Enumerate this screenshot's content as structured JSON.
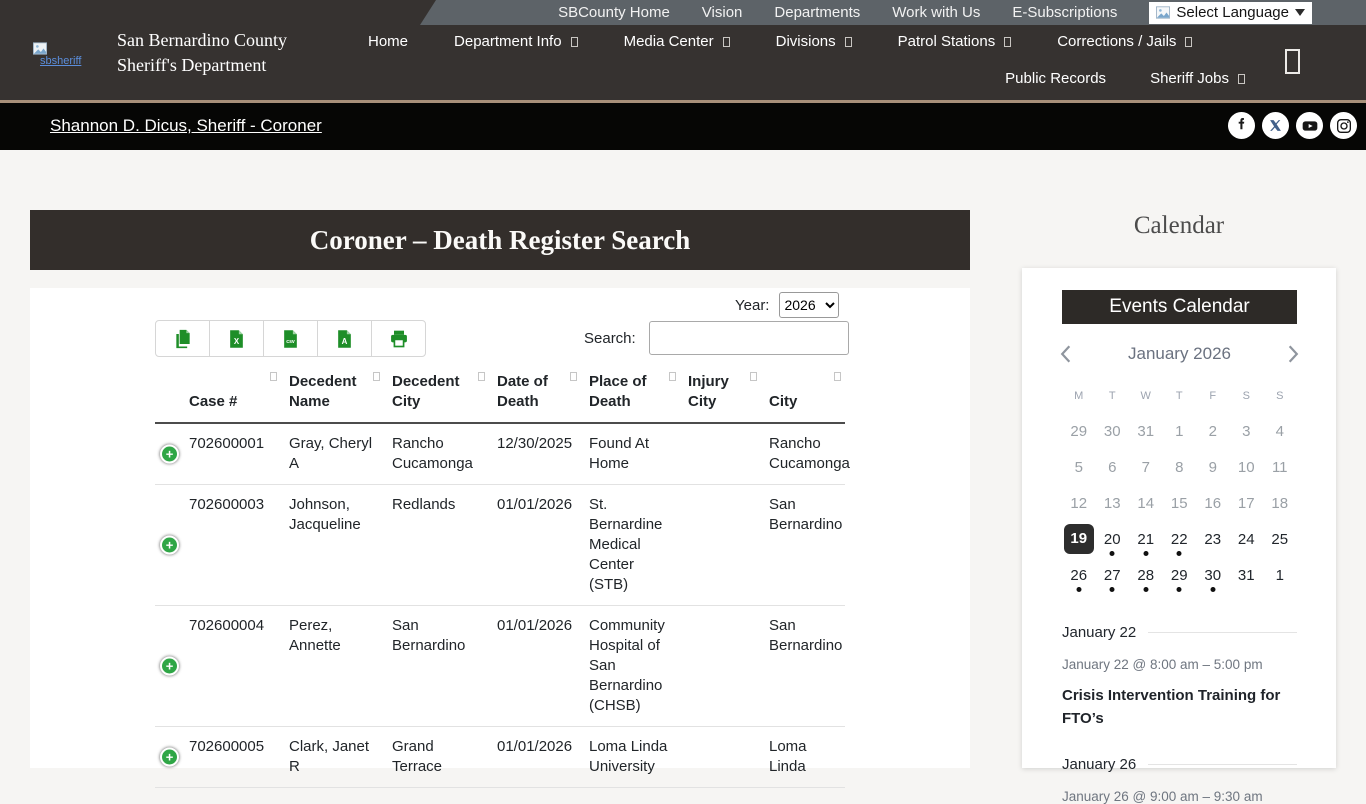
{
  "utility_nav": {
    "items": [
      "SBCounty Home",
      "Vision",
      "Departments",
      "Work with Us",
      "E-Subscriptions"
    ],
    "language_selector": "Select Language"
  },
  "header": {
    "logo_alt": "sbsheriff",
    "site_title_line1": "San Bernardino County",
    "site_title_line2": "Sheriff's Department",
    "nav_row1": [
      {
        "label": "Home",
        "dropdown": false
      },
      {
        "label": "Department Info",
        "dropdown": true
      },
      {
        "label": "Media Center",
        "dropdown": true
      },
      {
        "label": "Divisions",
        "dropdown": true
      },
      {
        "label": "Patrol Stations",
        "dropdown": true
      },
      {
        "label": "Corrections / Jails",
        "dropdown": true
      }
    ],
    "nav_row2": [
      {
        "label": "Public Records",
        "dropdown": false
      },
      {
        "label": "Sheriff Jobs",
        "dropdown": true
      }
    ]
  },
  "breadcrumb": {
    "label": "Shannon D. Dicus, Sheriff - Coroner"
  },
  "social_icons": [
    "facebook",
    "x-twitter",
    "youtube",
    "instagram"
  ],
  "main": {
    "title": "Coroner – Death Register Search",
    "year_label": "Year:",
    "year_value": "2026",
    "search_label": "Search:",
    "export_buttons": [
      "copy",
      "excel",
      "csv",
      "pdf",
      "print"
    ],
    "table": {
      "headers": [
        "Case #",
        "Decedent Name",
        "Decedent City",
        "Date of Death",
        "Place of Death",
        "Injury City",
        "City"
      ],
      "rows": [
        {
          "case_number": "702600001",
          "decedent_name": "Gray, Cheryl A",
          "decedent_city": "Rancho Cucamonga",
          "date_of_death": "12/30/2025",
          "place_of_death": "Found At Home",
          "injury_city": "",
          "city": "Rancho Cucamonga"
        },
        {
          "case_number": "702600003",
          "decedent_name": "Johnson, Jacqueline",
          "decedent_city": "Redlands",
          "date_of_death": "01/01/2026",
          "place_of_death": "St. Bernardine Medical Center (STB)",
          "injury_city": "",
          "city": "San Bernardino"
        },
        {
          "case_number": "702600004",
          "decedent_name": "Perez, Annette",
          "decedent_city": "San Bernardino",
          "date_of_death": "01/01/2026",
          "place_of_death": "Community Hospital of San Bernardino (CHSB)",
          "injury_city": "",
          "city": "San Bernardino"
        },
        {
          "case_number": "702600005",
          "decedent_name": "Clark, Janet R",
          "decedent_city": "Grand Terrace",
          "date_of_death": "01/01/2026",
          "place_of_death": "Loma Linda University",
          "injury_city": "",
          "city": "Loma Linda"
        }
      ]
    }
  },
  "sidebar": {
    "heading": "Calendar",
    "card_title": "Events Calendar",
    "calendar": {
      "month_label": "January 2026",
      "weekdays": [
        "M",
        "T",
        "W",
        "T",
        "F",
        "S",
        "S"
      ],
      "weeks": [
        [
          {
            "d": "29",
            "muted": true
          },
          {
            "d": "30",
            "muted": true
          },
          {
            "d": "31",
            "muted": true
          },
          {
            "d": "1",
            "muted": true
          },
          {
            "d": "2",
            "muted": true
          },
          {
            "d": "3",
            "muted": true
          },
          {
            "d": "4",
            "muted": true
          }
        ],
        [
          {
            "d": "5",
            "muted": true
          },
          {
            "d": "6",
            "muted": true
          },
          {
            "d": "7",
            "muted": true
          },
          {
            "d": "8",
            "muted": true
          },
          {
            "d": "9",
            "muted": true
          },
          {
            "d": "10",
            "muted": true
          },
          {
            "d": "11",
            "muted": true
          }
        ],
        [
          {
            "d": "12",
            "muted": true
          },
          {
            "d": "13",
            "muted": true
          },
          {
            "d": "14",
            "muted": true
          },
          {
            "d": "15",
            "muted": true
          },
          {
            "d": "16",
            "muted": true
          },
          {
            "d": "17",
            "muted": true
          },
          {
            "d": "18",
            "muted": true
          }
        ],
        [
          {
            "d": "19",
            "today": true
          },
          {
            "d": "20",
            "dot": true
          },
          {
            "d": "21",
            "dot": true
          },
          {
            "d": "22",
            "dot": true
          },
          {
            "d": "23"
          },
          {
            "d": "24"
          },
          {
            "d": "25"
          }
        ],
        [
          {
            "d": "26",
            "dot": true
          },
          {
            "d": "27",
            "dot": true
          },
          {
            "d": "28",
            "dot": true
          },
          {
            "d": "29",
            "dot": true
          },
          {
            "d": "30",
            "dot": true
          },
          {
            "d": "31"
          },
          {
            "d": "1"
          }
        ]
      ]
    },
    "events": [
      {
        "date": "January 22",
        "time": "January 22 @ 8:00 am – 5:00 pm",
        "title": "Crisis Intervention Training for FTO’s"
      },
      {
        "date": "January 26",
        "time": "January 26 @ 9:00 am – 9:30 am",
        "title": ""
      }
    ]
  }
}
